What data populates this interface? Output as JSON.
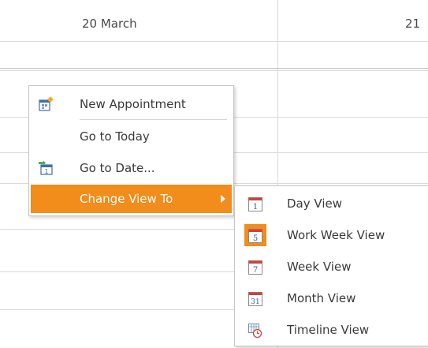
{
  "scheduler": {
    "day_left": "20 March",
    "day_right": "21"
  },
  "context_menu": {
    "items": [
      {
        "label": "New Appointment",
        "icon": "new-appointment-icon"
      },
      {
        "label": "Go to Today",
        "icon": ""
      },
      {
        "label": "Go to Date...",
        "icon": "go-to-date-icon"
      },
      {
        "label": "Change View To",
        "icon": "",
        "selected": true
      }
    ]
  },
  "view_submenu": {
    "items": [
      {
        "label": "Day View",
        "icon_text": "1",
        "icon": "day-view-icon"
      },
      {
        "label": "Work Week View",
        "icon_text": "5",
        "icon": "work-week-view-icon",
        "selected": true
      },
      {
        "label": "Week View",
        "icon_text": "7",
        "icon": "week-view-icon"
      },
      {
        "label": "Month View",
        "icon_text": "31",
        "icon": "month-view-icon"
      },
      {
        "label": "Timeline View",
        "icon_text": "",
        "icon": "timeline-view-icon"
      }
    ]
  },
  "colors": {
    "accent": "#f28c1a",
    "grid": "#dadada",
    "calendar_red": "#c8453c",
    "calendar_blue": "#3f6fa8"
  }
}
